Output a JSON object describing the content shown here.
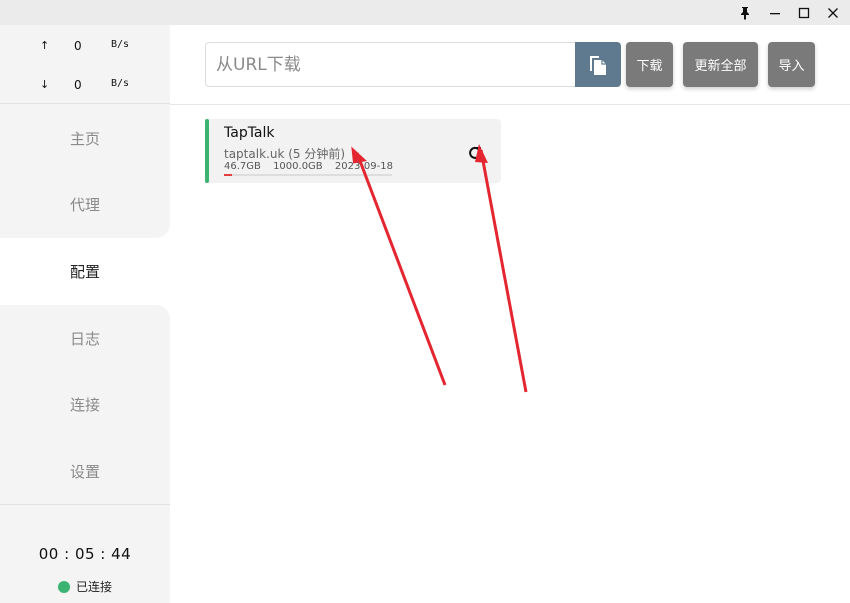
{
  "traffic": {
    "upload": {
      "arrow": "↑",
      "value": "0",
      "unit": "B/s"
    },
    "download": {
      "arrow": "↓",
      "value": "0",
      "unit": "B/s"
    }
  },
  "nav": {
    "items": [
      {
        "label": "主页",
        "active": false
      },
      {
        "label": "代理",
        "active": false
      },
      {
        "label": "配置",
        "active": true
      },
      {
        "label": "日志",
        "active": false
      },
      {
        "label": "连接",
        "active": false
      },
      {
        "label": "设置",
        "active": false
      }
    ]
  },
  "footer": {
    "uptime": "00 : 05 : 44",
    "status_label": "已连接",
    "status_color": "#3cb371"
  },
  "toolbar": {
    "url_placeholder": "从URL下载",
    "url_value": "",
    "download_label": "下载",
    "update_all_label": "更新全部",
    "import_label": "导入"
  },
  "profile": {
    "name": "TapTalk",
    "host": "taptalk.uk",
    "updated": "(5 分钟前)",
    "used": "46.7GB",
    "total": "1000.0GB",
    "expire": "2023-09-18",
    "usage_fraction": 0.047,
    "accent_color": "#3cb371"
  },
  "colors": {
    "accent": "#5f7a8f",
    "button": "#7a7a7a",
    "annotation": "#e32630"
  },
  "icons": {
    "pin": "pin-icon",
    "minimize": "minimize-icon",
    "maximize": "maximize-icon",
    "close": "close-icon",
    "paste": "clipboard-icon",
    "refresh": "refresh-icon"
  }
}
